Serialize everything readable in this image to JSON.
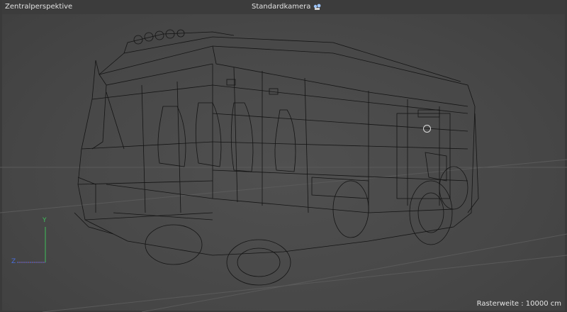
{
  "viewport": {
    "view_mode": "Zentralperspektive",
    "camera": "Standardkamera",
    "camera_icon": "camera-icon",
    "grid_spacing": "Rasterweite : 10000 cm"
  },
  "axis_gizmo": {
    "y_label": "Y",
    "z_label": "Z",
    "colors": {
      "y": "#3fbf5a",
      "z": "#4a6fe0",
      "x": "#d04a4a"
    }
  },
  "model": {
    "render_style": "wireframe",
    "wire_color": "#151515"
  }
}
